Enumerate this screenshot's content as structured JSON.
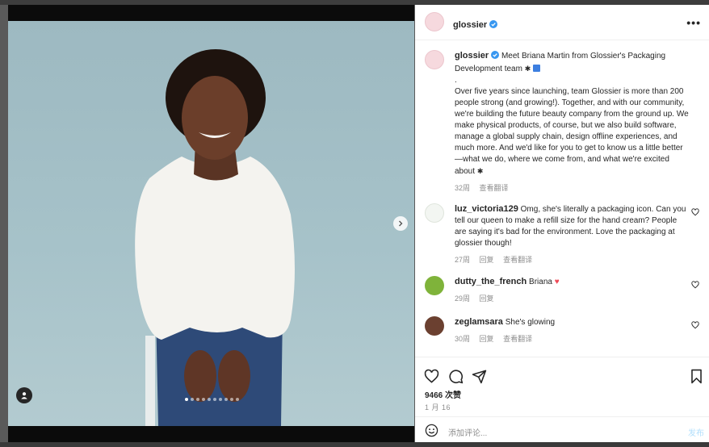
{
  "account": {
    "username": "glossier"
  },
  "caption": {
    "username": "glossier",
    "headline": "Meet Briana Martin from Glossier's Packaging Development team",
    "separator": ".",
    "body": "Over five years since launching, team Glossier is more than 200 people strong (and growing!). Together, and with our community, we're building the future beauty company from the ground up. We make physical products, of course, but we also build software, manage a global supply chain, design offline experiences, and much more. And we'd like for you to get to know us a little better—what we do, where we come from, and what we're excited about",
    "time": "32周",
    "translate": "查看翻译"
  },
  "comments": [
    {
      "username": "luz_victoria129",
      "text": "Omg, she's literally a packaging icon. Can you tell our queen to make a refill size for the hand cream? People are saying it's bad for the environment. Love the packaging at glossier though!",
      "time": "27周",
      "reply": "回复",
      "translate": "查看翻译"
    },
    {
      "username": "dutty_the_french",
      "text": "Briana",
      "time": "29周",
      "reply": "回复"
    },
    {
      "username": "zeglamsara",
      "text": "She's glowing",
      "time": "30周",
      "reply": "回复",
      "translate": "查看翻译"
    }
  ],
  "stats": {
    "likes": "9466 次赞",
    "date": "1 月 16"
  },
  "comment_box": {
    "placeholder": "添加评论...",
    "post_label": "发布"
  },
  "carousel": {
    "slide_count": 10,
    "active_index": 0
  },
  "icons": {
    "like": "heart-icon",
    "comment": "comment-icon",
    "share": "paper-plane-icon",
    "save": "bookmark-icon",
    "emoji": "smiley-icon",
    "next": "chevron-right-icon",
    "tag": "person-icon",
    "more": "more-options-icon"
  },
  "colors": {
    "verified": "#3897f0",
    "heart_red": "#ed4956",
    "post_button": "#b2dffc"
  }
}
